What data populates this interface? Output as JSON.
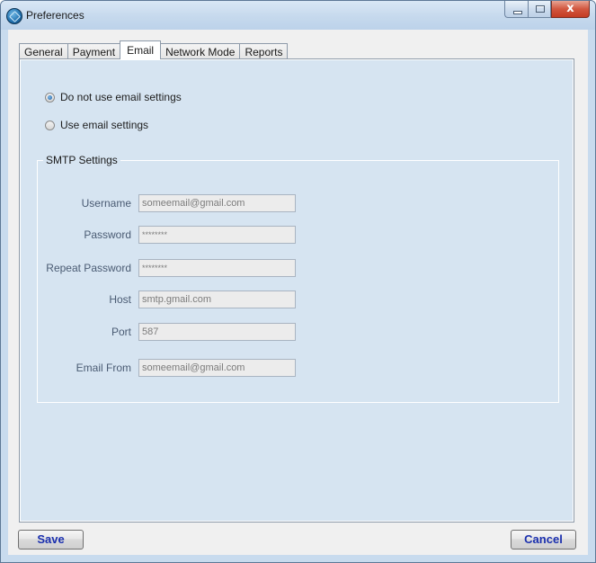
{
  "window": {
    "title": "Preferences",
    "controls": {
      "minimize": "minimize-icon",
      "maximize": "maximize-icon",
      "close": "close-icon",
      "close_glyph": "x"
    }
  },
  "tabs": [
    {
      "label": "General",
      "active": false
    },
    {
      "label": "Payment",
      "active": false
    },
    {
      "label": "Email",
      "active": true
    },
    {
      "label": "Network Mode",
      "active": false
    },
    {
      "label": "Reports",
      "active": false
    }
  ],
  "email": {
    "options": [
      {
        "label": "Do not use email settings",
        "selected": true
      },
      {
        "label": "Use email settings",
        "selected": false
      }
    ],
    "smtp": {
      "group_label": "SMTP Settings",
      "fields": [
        {
          "label": "Username",
          "value": "someemail@gmail.com"
        },
        {
          "label": "Password",
          "value": "********"
        },
        {
          "label": "Repeat Password",
          "value": "********"
        },
        {
          "label": "Host",
          "value": "smtp.gmail.com"
        },
        {
          "label": "Port",
          "value": "587"
        },
        {
          "label": "Email From",
          "value": "someemail@gmail.com"
        }
      ]
    }
  },
  "buttons": {
    "save": "Save",
    "cancel": "Cancel"
  },
  "colors": {
    "panel": "#d6e4f1",
    "button_text": "#1a2fae",
    "field_label": "#4a5b73"
  }
}
